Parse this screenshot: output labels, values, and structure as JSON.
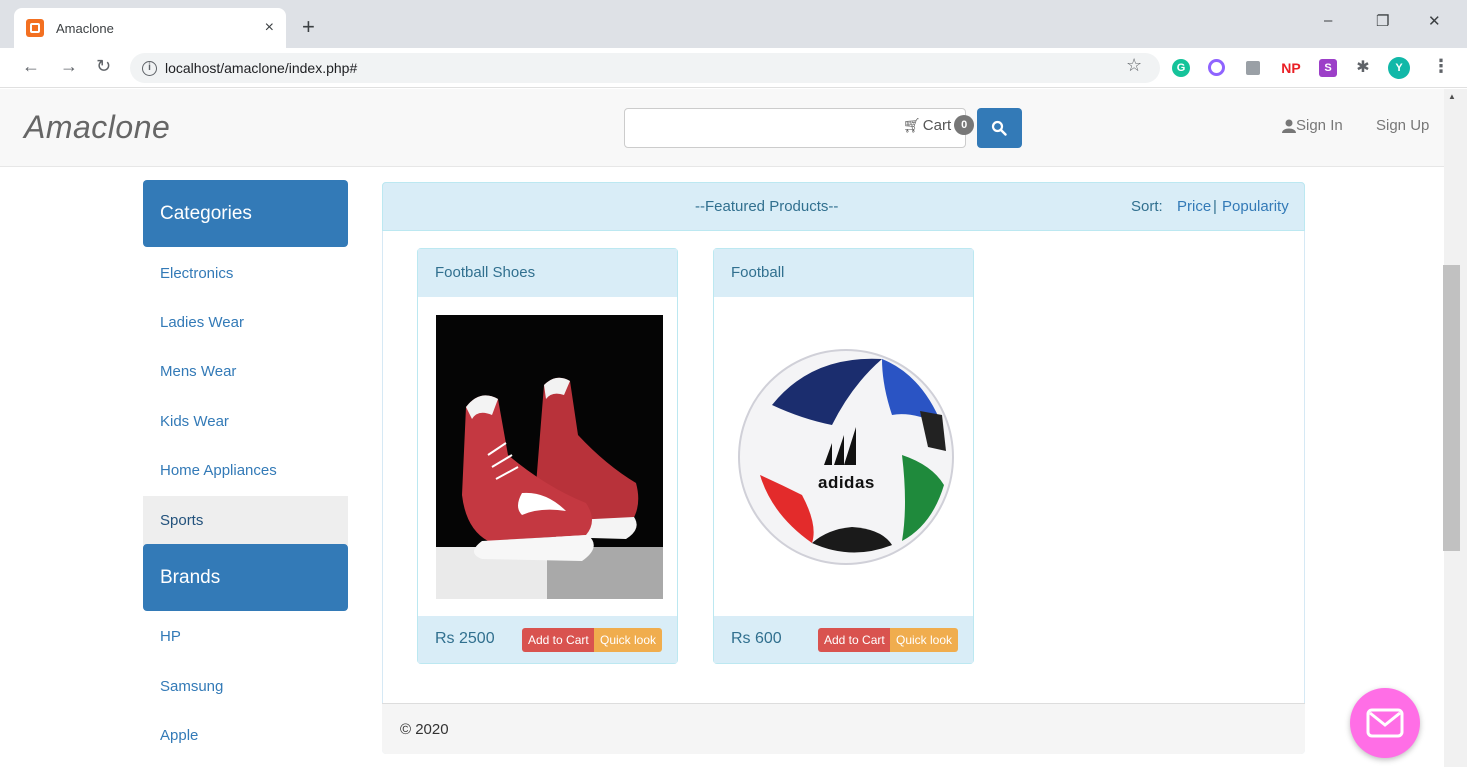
{
  "browser": {
    "tab_title": "Amaclone",
    "tab_close": "×",
    "new_tab": "+",
    "url": "localhost/amaclone/index.php#",
    "controls": {
      "minimize": "–",
      "restore": "❐",
      "close": "✕"
    },
    "extensions": [
      {
        "name": "grammarly",
        "label": "G",
        "color": "#15c39a"
      },
      {
        "name": "ring",
        "label": "",
        "color": "#8f63ff"
      },
      {
        "name": "gray-ext",
        "label": "",
        "color": "#9aa0a6"
      },
      {
        "name": "np",
        "label": "NP",
        "color": "#ea1f25"
      },
      {
        "name": "s-ext",
        "label": "S",
        "color": "#9c3fc8"
      },
      {
        "name": "puzzle",
        "label": "",
        "color": "#5f6368"
      },
      {
        "name": "profile",
        "label": "Y",
        "color": "#11b8a8"
      }
    ]
  },
  "site": {
    "brand": "Amaclone",
    "cart_label": "Cart",
    "cart_count": "0",
    "sign_in": "Sign In",
    "sign_up": "Sign Up"
  },
  "sidebar": {
    "categories_title": "Categories",
    "categories": [
      "Electronics",
      "Ladies Wear",
      "Mens Wear",
      "Kids Wear",
      "Home Appliances",
      "Sports"
    ],
    "active_category": "Sports",
    "brands_title": "Brands",
    "brands": [
      "HP",
      "Samsung",
      "Apple"
    ]
  },
  "main": {
    "heading": "--Featured Products--",
    "sort_label": "Sort:",
    "sort_price": "Price",
    "sort_sep": "|",
    "sort_popularity": "Popularity",
    "products": [
      {
        "name": "Football Shoes",
        "price": "Rs 2500",
        "add_to_cart": "Add to Cart",
        "quick_look": "Quick look"
      },
      {
        "name": "Football",
        "price": "Rs 600",
        "add_to_cart": "Add to Cart",
        "quick_look": "Quick look",
        "ball_text": "adidas"
      }
    ],
    "footer": "© 2020"
  },
  "colors": {
    "primary": "#337ab7",
    "panel_info": "#d9edf7",
    "danger": "#d9534f",
    "warning": "#f0ad4e",
    "chat": "#ff6ee6"
  }
}
